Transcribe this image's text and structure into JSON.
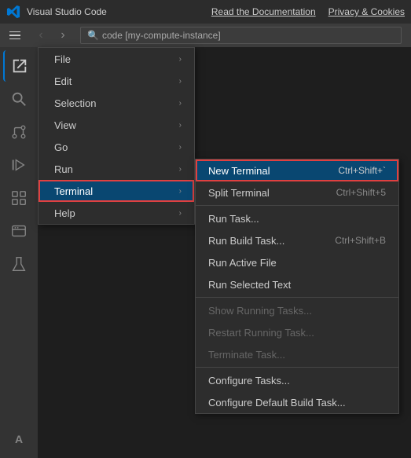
{
  "titleBar": {
    "appName": "Visual Studio Code",
    "links": [
      "Read the Documentation",
      "Privacy & Cookies"
    ]
  },
  "menuBar": {
    "backArrow": "‹",
    "forwardArrow": "›",
    "searchPlaceholder": "code [my-compute-instance]"
  },
  "sidebar": {
    "icons": [
      {
        "name": "explorer-icon",
        "symbol": "⧉"
      },
      {
        "name": "search-icon",
        "symbol": "🔍"
      },
      {
        "name": "source-control-icon",
        "symbol": "⎇"
      },
      {
        "name": "run-debug-icon",
        "symbol": "▷"
      },
      {
        "name": "extensions-icon",
        "symbol": "⊞"
      },
      {
        "name": "remote-explorer-icon",
        "symbol": "⬡"
      },
      {
        "name": "test-icon",
        "symbol": "⚗"
      },
      {
        "name": "accounts-icon",
        "symbol": "A"
      }
    ]
  },
  "fileMenu": {
    "items": [
      {
        "label": "File",
        "hasArrow": true
      },
      {
        "label": "Edit",
        "hasArrow": true
      },
      {
        "label": "Selection",
        "hasArrow": true
      },
      {
        "label": "View",
        "hasArrow": true
      },
      {
        "label": "Go",
        "hasArrow": true
      },
      {
        "label": "Run",
        "hasArrow": true
      },
      {
        "label": "Terminal",
        "hasArrow": true,
        "active": true
      },
      {
        "label": "Help",
        "hasArrow": true
      }
    ]
  },
  "terminalSubmenu": {
    "items": [
      {
        "label": "New Terminal",
        "shortcut": "Ctrl+Shift+`",
        "active": true
      },
      {
        "label": "Split Terminal",
        "shortcut": "Ctrl+Shift+5"
      },
      {
        "label": "",
        "separator": true
      },
      {
        "label": "Run Task...",
        "shortcut": ""
      },
      {
        "label": "Run Build Task...",
        "shortcut": "Ctrl+Shift+B"
      },
      {
        "label": "Run Active File",
        "shortcut": ""
      },
      {
        "label": "Run Selected Text",
        "shortcut": ""
      },
      {
        "label": "",
        "separator": true
      },
      {
        "label": "Show Running Tasks...",
        "shortcut": "",
        "disabled": true
      },
      {
        "label": "Restart Running Task...",
        "shortcut": "",
        "disabled": true
      },
      {
        "label": "Terminate Task...",
        "shortcut": "",
        "disabled": true
      },
      {
        "label": "",
        "separator": true
      },
      {
        "label": "Configure Tasks...",
        "shortcut": ""
      },
      {
        "label": "Configure Default Build Task...",
        "shortcut": ""
      }
    ]
  }
}
